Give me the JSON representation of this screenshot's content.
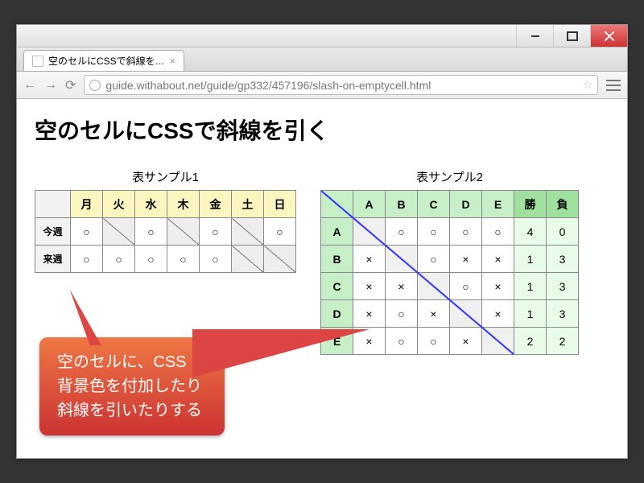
{
  "browser": {
    "tab_title": "空のセルにCSSで斜線を…",
    "url": "guide.withabout.net/guide/gp332/457196/slash-on-emptycell.html"
  },
  "page": {
    "title": "空のセルにCSSで斜線を引く"
  },
  "table1": {
    "caption": "表サンプル1",
    "cols": [
      "月",
      "火",
      "水",
      "木",
      "金",
      "土",
      "日"
    ],
    "rows": [
      {
        "head": "今週",
        "cells": [
          "○",
          "/",
          "○",
          "/",
          "○",
          "/",
          "○"
        ]
      },
      {
        "head": "来週",
        "cells": [
          "○",
          "○",
          "○",
          "○",
          "○",
          "/",
          "/"
        ]
      }
    ]
  },
  "table2": {
    "caption": "表サンプル2",
    "cols": [
      "A",
      "B",
      "C",
      "D",
      "E"
    ],
    "extra_cols": [
      "勝",
      "負"
    ],
    "rows": [
      {
        "head": "A",
        "cells": [
          "",
          "○",
          "○",
          "○",
          "○"
        ],
        "win": "4",
        "lose": "0"
      },
      {
        "head": "B",
        "cells": [
          "×",
          "",
          "○",
          "×",
          "×"
        ],
        "win": "1",
        "lose": "3"
      },
      {
        "head": "C",
        "cells": [
          "×",
          "×",
          "",
          "○",
          "×"
        ],
        "win": "1",
        "lose": "3"
      },
      {
        "head": "D",
        "cells": [
          "×",
          "○",
          "×",
          "",
          "×"
        ],
        "win": "1",
        "lose": "3"
      },
      {
        "head": "E",
        "cells": [
          "×",
          "○",
          "○",
          "×",
          ""
        ],
        "win": "2",
        "lose": "2"
      }
    ]
  },
  "callout": {
    "line1": "空のセルに、CSS で",
    "line2": "背景色を付加したり",
    "line3": "斜線を引いたりする"
  }
}
